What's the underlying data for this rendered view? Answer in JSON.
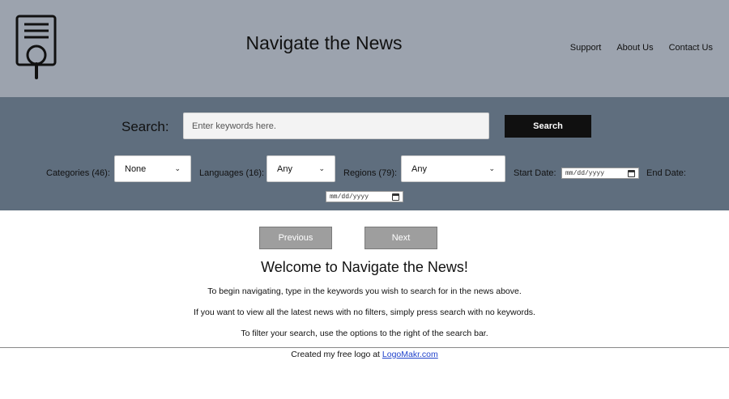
{
  "header": {
    "title": "Navigate the News",
    "nav": [
      "Support",
      "About Us",
      "Contact Us"
    ]
  },
  "search": {
    "label": "Search:",
    "placeholder": "Enter keywords here.",
    "button": "Search"
  },
  "filters": {
    "categories": {
      "label": "Categories (46):",
      "selected": "None"
    },
    "languages": {
      "label": "Languages (16):",
      "selected": "Any"
    },
    "regions": {
      "label": "Regions (79):",
      "selected": "Any"
    },
    "start_date": {
      "label": "Start Date:",
      "value": "mm/dd/yyyy"
    },
    "end_date": {
      "label": "End Date:",
      "value": "mm/dd/yyyy"
    }
  },
  "pager": {
    "previous": "Previous",
    "next": "Next"
  },
  "welcome": {
    "title": "Welcome to Navigate the News!",
    "lines": [
      "To begin navigating, type in the keywords you wish to search for in the news above.",
      "If you want to view all the latest news with no filters, simply press search with no keywords.",
      "To filter your search, use the options to the right of the search bar."
    ]
  },
  "footer": {
    "text": "Created my free logo at",
    "link": "LogoMakr.com"
  },
  "colors": {
    "header_bg": "#9ca3ae",
    "search_bg": "#5f6e7e",
    "button_bg": "#101010",
    "pager_bg": "#9e9e9e",
    "link": "#2244cc"
  }
}
